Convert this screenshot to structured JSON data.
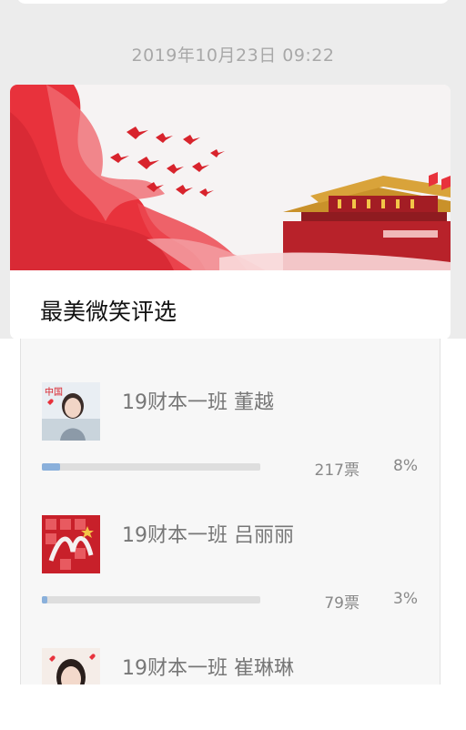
{
  "timestamp": "2019年10月23日 09:22",
  "article": {
    "title": "最美微笑评选",
    "banner_icon": "red-flag-banner-image"
  },
  "poll": {
    "bar_color": "#8ab0db",
    "items": [
      {
        "name": "19财本一班 董越",
        "votes": "217票",
        "percent": "8%",
        "share": 0.08,
        "thumb_label": "中国"
      },
      {
        "name": "19财本一班 吕丽丽",
        "votes": "79票",
        "percent": "3%",
        "share": 0.03,
        "thumb_label": ""
      },
      {
        "name": "19财本一班 崔琳琳",
        "votes": "",
        "percent": "",
        "share": 0,
        "thumb_label": ""
      }
    ]
  },
  "colors": {
    "accent_red": "#e8323c",
    "background": "#ececec"
  }
}
